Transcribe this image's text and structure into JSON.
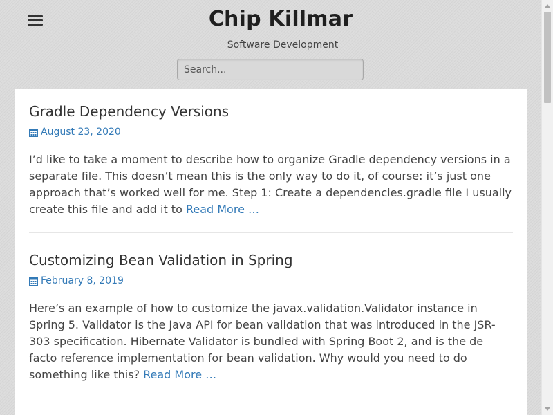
{
  "header": {
    "menu_icon": "hamburger-menu-icon",
    "title": "Chip Killmar",
    "tagline": "Software Development",
    "search": {
      "placeholder": "Search...",
      "value": ""
    }
  },
  "posts": [
    {
      "title": "Gradle Dependency Versions",
      "date": "August 23, 2020",
      "date_icon": "calendar-icon",
      "excerpt": "I’d like to take a moment to describe how to organize Gradle dependency versions in a separate file.  This doesn’t mean this is the only way to do it, of course: it’s just one approach that’s worked well for me. Step 1: Create a dependencies.gradle file I usually create this file and add it to ",
      "read_more": "Read More …"
    },
    {
      "title": "Customizing Bean Validation in Spring",
      "date": "February 8, 2019",
      "date_icon": "calendar-icon",
      "excerpt": "Here’s an example of how to customize the javax.validation.Validator instance in Spring 5.  Validator is the Java API for bean validation that was introduced in the JSR-303 specification.  Hibernate Validator is bundled with Spring Boot 2, and is the de facto reference implementation for bean validation. Why would you need to do something like this? ",
      "read_more": "Read More …"
    }
  ],
  "colors": {
    "link": "#337ab7",
    "text": "#444444",
    "title": "#1f1f1f",
    "background": "#dcdcdc",
    "card": "#ffffff"
  },
  "scrollbar": {
    "up_icon": "scroll-up-arrow-icon",
    "down_icon": "scroll-down-arrow-icon"
  }
}
